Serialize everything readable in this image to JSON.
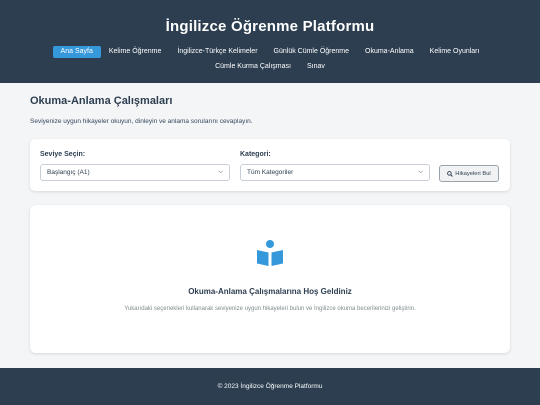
{
  "header": {
    "title": "İngilizce Öğrenme Platformu",
    "nav": [
      {
        "label": "Ana Sayfa",
        "active": true
      },
      {
        "label": "Kelime Öğrenme",
        "active": false
      },
      {
        "label": "İngilizce-Türkçe Kelimeler",
        "active": false
      },
      {
        "label": "Günlük Cümle Öğrenme",
        "active": false
      },
      {
        "label": "Okuma-Anlama",
        "active": false
      },
      {
        "label": "Kelime Oyunları",
        "active": false
      },
      {
        "label": "Cümle Kurma Çalışması",
        "active": false
      },
      {
        "label": "Sınav",
        "active": false
      }
    ]
  },
  "main": {
    "title": "Okuma-Anlama Çalışmaları",
    "description": "Seviyenize uygun hikayeler okuyun, dinleyin ve anlama sorularını cevaplayın."
  },
  "filters": {
    "level_label": "Seviye Seçin:",
    "level_value": "Başlangıç (A1)",
    "category_label": "Kategori:",
    "category_value": "Tüm Kategoriler",
    "search_button": "Hikayeleri Bul"
  },
  "welcome": {
    "icon": "book-reader-icon",
    "title": "Okuma-Anlama Çalışmalarına Hoş Geldiniz",
    "text": "Yukarıdaki seçenekleri kullanarak seviyenize uygun hikayeleri bulun ve İngilizce okuma becerilerinizi geliştirin."
  },
  "footer": {
    "text": "© 2023 İngilizce Öğrenme Platformu"
  },
  "colors": {
    "header_bg": "#2c3e50",
    "accent": "#3498db",
    "page_bg": "#f4f5f7"
  }
}
